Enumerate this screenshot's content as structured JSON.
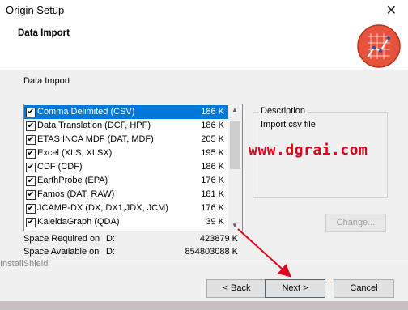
{
  "window": {
    "title": "Origin Setup",
    "close_glyph": "✕"
  },
  "header": {
    "title": "Data Import"
  },
  "group_label": "Data Import",
  "list": [
    {
      "name": "Comma Delimited (CSV)",
      "size": "186 K",
      "checked": true,
      "selected": true
    },
    {
      "name": "Data Translation (DCF, HPF)",
      "size": "186 K",
      "checked": true
    },
    {
      "name": "ETAS INCA MDF (DAT, MDF)",
      "size": "205 K",
      "checked": true
    },
    {
      "name": "Excel (XLS, XLSX)",
      "size": "195 K",
      "checked": true
    },
    {
      "name": "CDF (CDF)",
      "size": "186 K",
      "checked": true
    },
    {
      "name": "EarthProbe (EPA)",
      "size": "176 K",
      "checked": true
    },
    {
      "name": "Famos (DAT, RAW)",
      "size": "181 K",
      "checked": true
    },
    {
      "name": "JCAMP-DX (DX, DX1,JDX, JCM)",
      "size": "176 K",
      "checked": true
    },
    {
      "name": "KaleidaGraph (QDA)",
      "size": "39 K",
      "checked": true
    }
  ],
  "space_required": {
    "label": "Space Required on",
    "drive": "D:",
    "value": "423879 K"
  },
  "space_available": {
    "label": "Space Available on",
    "drive": "D:",
    "value": "854803088 K"
  },
  "description": {
    "title": "Description",
    "text": "Import csv file"
  },
  "watermark": "www.dgrai.com",
  "buttons": {
    "change": "Change...",
    "back": "< Back",
    "next": "Next >",
    "cancel": "Cancel"
  },
  "footer_brand": "InstallShield",
  "colors": {
    "selection": "#0078d7",
    "annotation_arrow": "#e0001a",
    "watermark": "#e0001a"
  },
  "icons": {
    "checkbox": "✔",
    "scroll_up": "▲",
    "scroll_down": "▼"
  }
}
